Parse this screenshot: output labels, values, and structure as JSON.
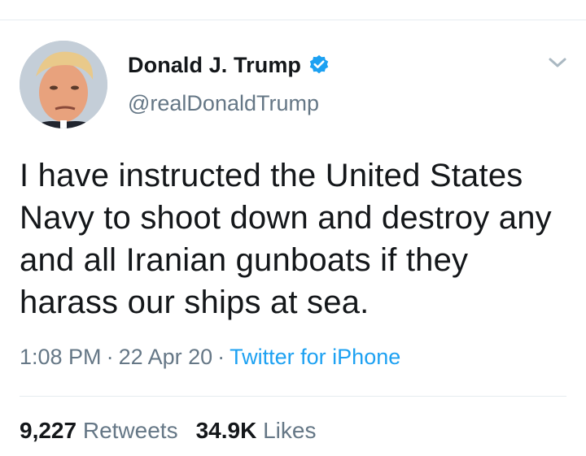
{
  "user": {
    "display_name": "Donald J. Trump",
    "handle": "@realDonaldTrump",
    "verified": true
  },
  "tweet": {
    "text": "I have instructed the United States Navy to shoot down and destroy any and all Iranian gunboats if they harass our ships at sea.",
    "time": "1:08 PM",
    "date": "22 Apr 20",
    "source": "Twitter for iPhone"
  },
  "stats": {
    "retweets_count": "9,227",
    "retweets_label": "Retweets",
    "likes_count": "34.9K",
    "likes_label": "Likes"
  },
  "colors": {
    "accent": "#1da1f2",
    "muted": "#657786",
    "text": "#14171a"
  },
  "icons": {
    "verified": "verified-badge-icon",
    "menu": "chevron-down-icon"
  }
}
